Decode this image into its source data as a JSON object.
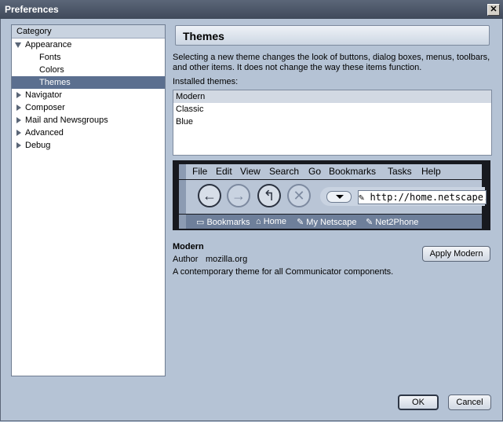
{
  "window": {
    "title": "Preferences"
  },
  "sidebar": {
    "header": "Category",
    "items": [
      {
        "label": "Appearance",
        "level": 1,
        "expanded": true
      },
      {
        "label": "Fonts",
        "level": 2
      },
      {
        "label": "Colors",
        "level": 2
      },
      {
        "label": "Themes",
        "level": 2,
        "selected": true
      },
      {
        "label": "Navigator",
        "level": 1,
        "expanded": false
      },
      {
        "label": "Composer",
        "level": 1,
        "expanded": false
      },
      {
        "label": "Mail and Newsgroups",
        "level": 1,
        "expanded": false
      },
      {
        "label": "Advanced",
        "level": 1,
        "expanded": false
      },
      {
        "label": "Debug",
        "level": 1,
        "expanded": false
      }
    ]
  },
  "main": {
    "title": "Themes",
    "description": "Selecting a new theme changes the look of buttons, dialog boxes, menus, toolbars, and other items. It does not change the way these items function.",
    "installed_label": "Installed themes:",
    "themes": [
      "Modern",
      "Classic",
      "Blue"
    ],
    "selected_theme_index": 0,
    "preview": {
      "menu": [
        "File",
        "Edit",
        "View",
        "Search",
        "Go",
        "Bookmarks",
        "Tasks",
        "Help"
      ],
      "url": "http://home.netscape.co",
      "personal_bar": [
        "Bookmarks",
        "Home",
        "My Netscape",
        "Net2Phone"
      ]
    },
    "info": {
      "name": "Modern",
      "author_label": "Author",
      "author_value": "mozilla.org",
      "description": "A contemporary theme for all Communicator components."
    },
    "apply_button": "Apply Modern"
  },
  "footer": {
    "ok": "OK",
    "cancel": "Cancel"
  }
}
